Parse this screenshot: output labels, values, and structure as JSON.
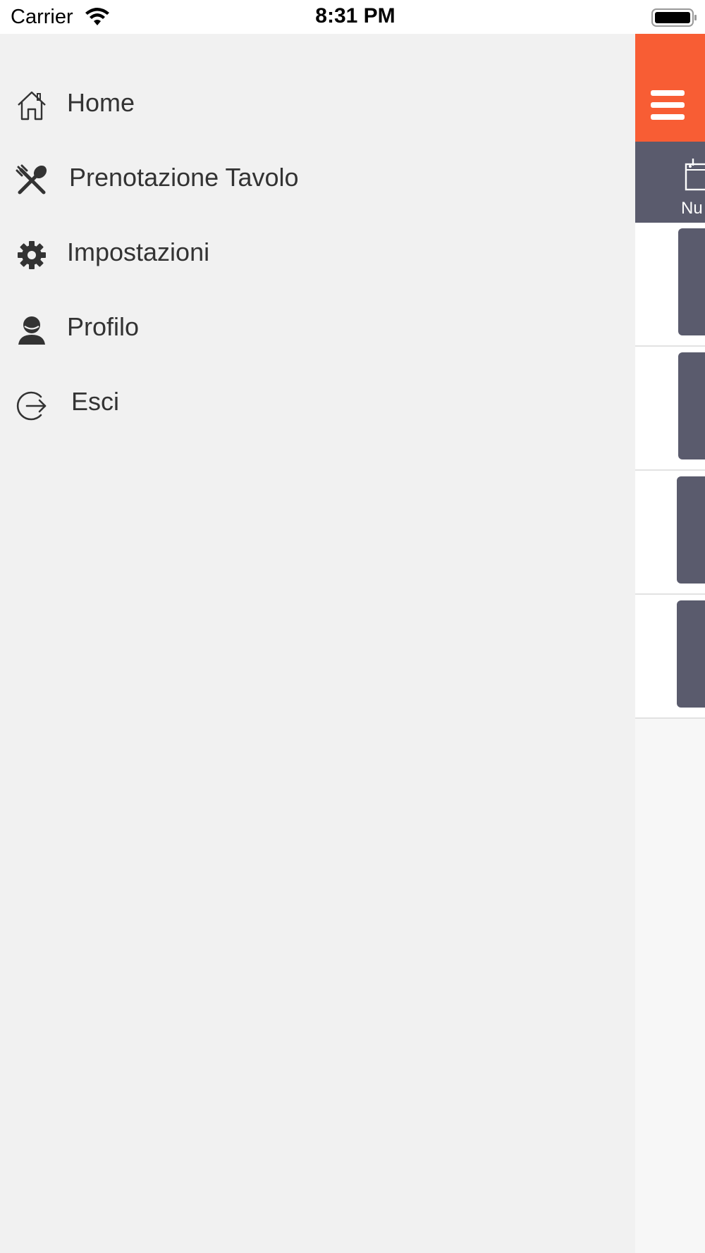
{
  "status_bar": {
    "carrier": "Carrier",
    "time": "8:31 PM",
    "wifi_icon": "wifi-icon",
    "battery_icon": "battery-icon"
  },
  "drawer": {
    "items": [
      {
        "label": "Home",
        "icon": "home-icon"
      },
      {
        "label": "Prenotazione Tavolo",
        "icon": "fork-spoon-icon"
      },
      {
        "label": "Impostazioni",
        "icon": "gear-icon"
      },
      {
        "label": "Profilo",
        "icon": "user-icon"
      },
      {
        "label": "Esci",
        "icon": "logout-icon"
      }
    ]
  },
  "main": {
    "menu_icon": "hamburger-icon",
    "toolbar": {
      "new_label": "Nu",
      "icon": "calendar-icon"
    }
  },
  "colors": {
    "accent": "#f85d34",
    "toolbar": "#5a5b6d",
    "drawer_bg": "#f1f1f1",
    "text": "#333333"
  }
}
